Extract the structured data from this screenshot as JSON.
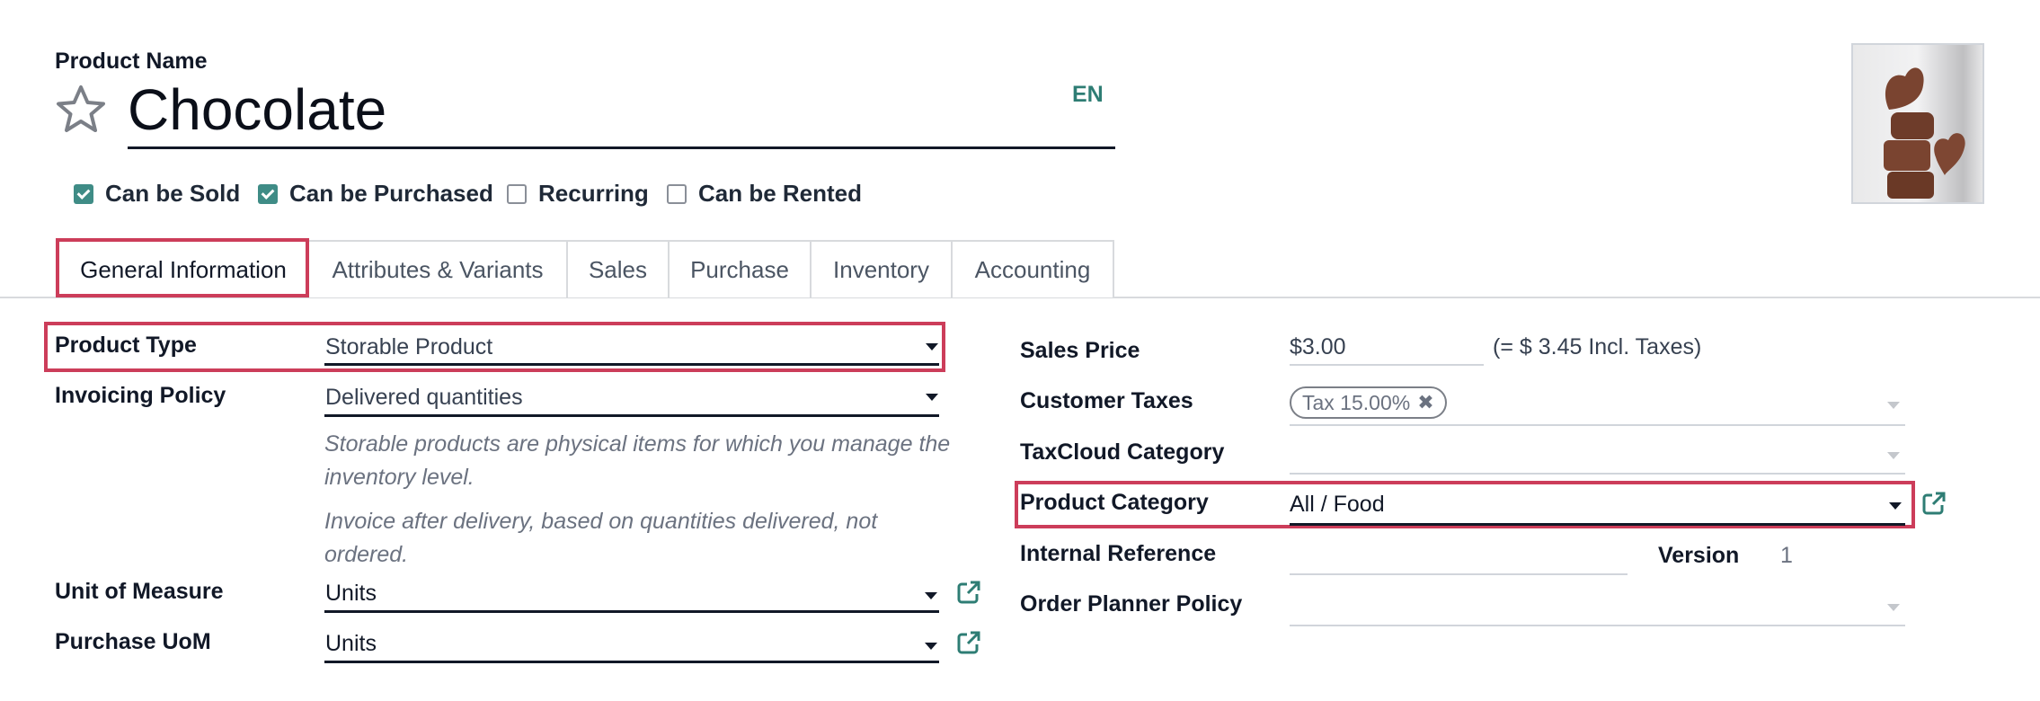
{
  "header": {
    "name_label": "Product Name",
    "product_name": "Chocolate",
    "language": "EN",
    "favorite": false,
    "image_alt": "Chocolate hearts stacked"
  },
  "flags": [
    {
      "label": "Can be Sold",
      "checked": true
    },
    {
      "label": "Can be Purchased",
      "checked": true
    },
    {
      "label": "Recurring",
      "checked": false
    },
    {
      "label": "Can be Rented",
      "checked": false
    }
  ],
  "tabs": [
    {
      "label": "General Information",
      "active": true
    },
    {
      "label": "Attributes & Variants",
      "active": false
    },
    {
      "label": "Sales",
      "active": false
    },
    {
      "label": "Purchase",
      "active": false
    },
    {
      "label": "Inventory",
      "active": false
    },
    {
      "label": "Accounting",
      "active": false
    }
  ],
  "left": {
    "product_type": {
      "label": "Product Type",
      "value": "Storable Product"
    },
    "invoicing_policy": {
      "label": "Invoicing Policy",
      "value": "Delivered quantities"
    },
    "help_type": "Storable products are physical items for which you manage the inventory level.",
    "help_invoice": "Invoice after delivery, based on quantities delivered, not ordered.",
    "uom": {
      "label": "Unit of Measure",
      "value": "Units"
    },
    "purchase_uom": {
      "label": "Purchase UoM",
      "value": "Units"
    }
  },
  "right": {
    "sales_price": {
      "label": "Sales Price",
      "value": "$3.00",
      "incl_taxes": "(= $ 3.45 Incl. Taxes)"
    },
    "customer_taxes": {
      "label": "Customer Taxes",
      "tags": [
        "Tax 15.00%"
      ]
    },
    "taxcloud_category": {
      "label": "TaxCloud Category",
      "value": ""
    },
    "product_category": {
      "label": "Product Category",
      "value": "All / Food"
    },
    "internal_reference": {
      "label": "Internal Reference",
      "value": ""
    },
    "version": {
      "label": "Version",
      "value": "1"
    },
    "order_planner_policy": {
      "label": "Order Planner Policy",
      "value": ""
    }
  },
  "colors": {
    "accent": "#3f8c86",
    "link": "#2e7d74",
    "highlight": "#cc3d5a"
  }
}
